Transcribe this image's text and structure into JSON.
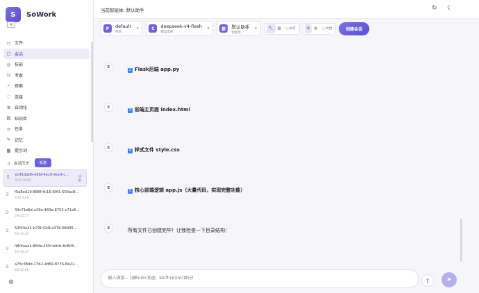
{
  "brand": {
    "name": "SoWork",
    "logo_letter": "S",
    "collapse": "<"
  },
  "nav": [
    {
      "icon": "folder-icon",
      "glyph": "▭",
      "label": "文件",
      "active": false
    },
    {
      "icon": "chat-icon",
      "glyph": "▢",
      "label": "会话",
      "active": true
    },
    {
      "icon": "skill-icon",
      "glyph": "◎",
      "label": "技能",
      "active": false
    },
    {
      "icon": "expert-icon",
      "glyph": "U",
      "label": "专家",
      "active": false
    },
    {
      "icon": "explore-icon",
      "glyph": "⌕",
      "label": "探索",
      "active": false
    },
    {
      "icon": "connect-icon",
      "glyph": "◌",
      "label": "连接",
      "active": false
    },
    {
      "icon": "automation-icon",
      "glyph": "⚙",
      "label": "自动化",
      "active": false
    },
    {
      "icon": "knowledge-icon",
      "glyph": "▤",
      "label": "知识库",
      "active": false
    },
    {
      "icon": "task-icon",
      "glyph": "≡",
      "label": "任务",
      "active": false
    },
    {
      "icon": "memory-icon",
      "glyph": "✎",
      "label": "记忆",
      "active": false
    },
    {
      "icon": "prompt-icon",
      "glyph": "▦",
      "label": "提示词",
      "active": false
    }
  ],
  "history": {
    "label": "会话历史",
    "new_label": "新建"
  },
  "sessions": [
    {
      "id": "ec41da06-e8bf-4ec9-9ec9-c...",
      "time": "5/10 18:45",
      "badge": "当前",
      "active": true
    },
    {
      "id": "f5a8ed19-888f-4c16-89f1-500ac8...",
      "time": "5/10 0:03",
      "badge": "",
      "active": false
    },
    {
      "id": "33c71e6d-a29a-469e-8753-c71a5...",
      "time": "5/9 22:37",
      "badge": "",
      "active": false
    },
    {
      "id": "52f03a25-b79f-424f-a378-08d35...",
      "time": "5/9 22:36",
      "badge": "",
      "active": false
    },
    {
      "id": "080faaa3-884e-455f-b0cb-8c808...",
      "time": "5/9 22:27",
      "badge": "",
      "active": false
    },
    {
      "id": "a75c389d-17b2-4d69-8776-8e21...",
      "time": "5/9 22:26",
      "badge": "",
      "active": false
    }
  ],
  "topbar": {
    "current_agent": "当前智能体: 默认助手"
  },
  "toolbar": {
    "project": {
      "badge": "P",
      "main": "default",
      "sub": "项目"
    },
    "model": {
      "badge": "C",
      "main": "deepseek-v4-flash",
      "sub": "模型选择"
    },
    "agent": {
      "badge": "默",
      "main": "默认助手",
      "sub": "智能体"
    },
    "group1": [
      {
        "glyph": "🔧",
        "label": "",
        "on": true
      },
      {
        "glyph": "▥",
        "label": "",
        "on": false
      },
      {
        "glyph": "◌",
        "label": "执行",
        "on": false
      }
    ],
    "group2": [
      {
        "glyph": "⊕",
        "label": "",
        "on": true
      },
      {
        "glyph": "◍",
        "label": "",
        "on": false
      },
      {
        "glyph": "◌",
        "label": "文档",
        "on": false
      }
    ],
    "create_label": "创建会话"
  },
  "messages": [
    {
      "avatar": "E",
      "num": "2",
      "text": "Flask后端 app.py",
      "bold": true
    },
    {
      "avatar": "E",
      "num": "3",
      "text": "前端主页面 index.html",
      "bold": true
    },
    {
      "avatar": "E",
      "num": "4",
      "text": "样式文件 style.css",
      "bold": true
    },
    {
      "avatar": "E",
      "num": "5",
      "text": "核心前端逻辑 app.js（大量代码，实现完整功能）",
      "bold": true
    },
    {
      "avatar": "E",
      "num": "",
      "text": "所有文件已创建完毕！让我检查一下目录结构：",
      "bold": false
    }
  ],
  "input": {
    "placeholder": "输入消息... (按Enter发送，Shift+Enter换行)"
  }
}
